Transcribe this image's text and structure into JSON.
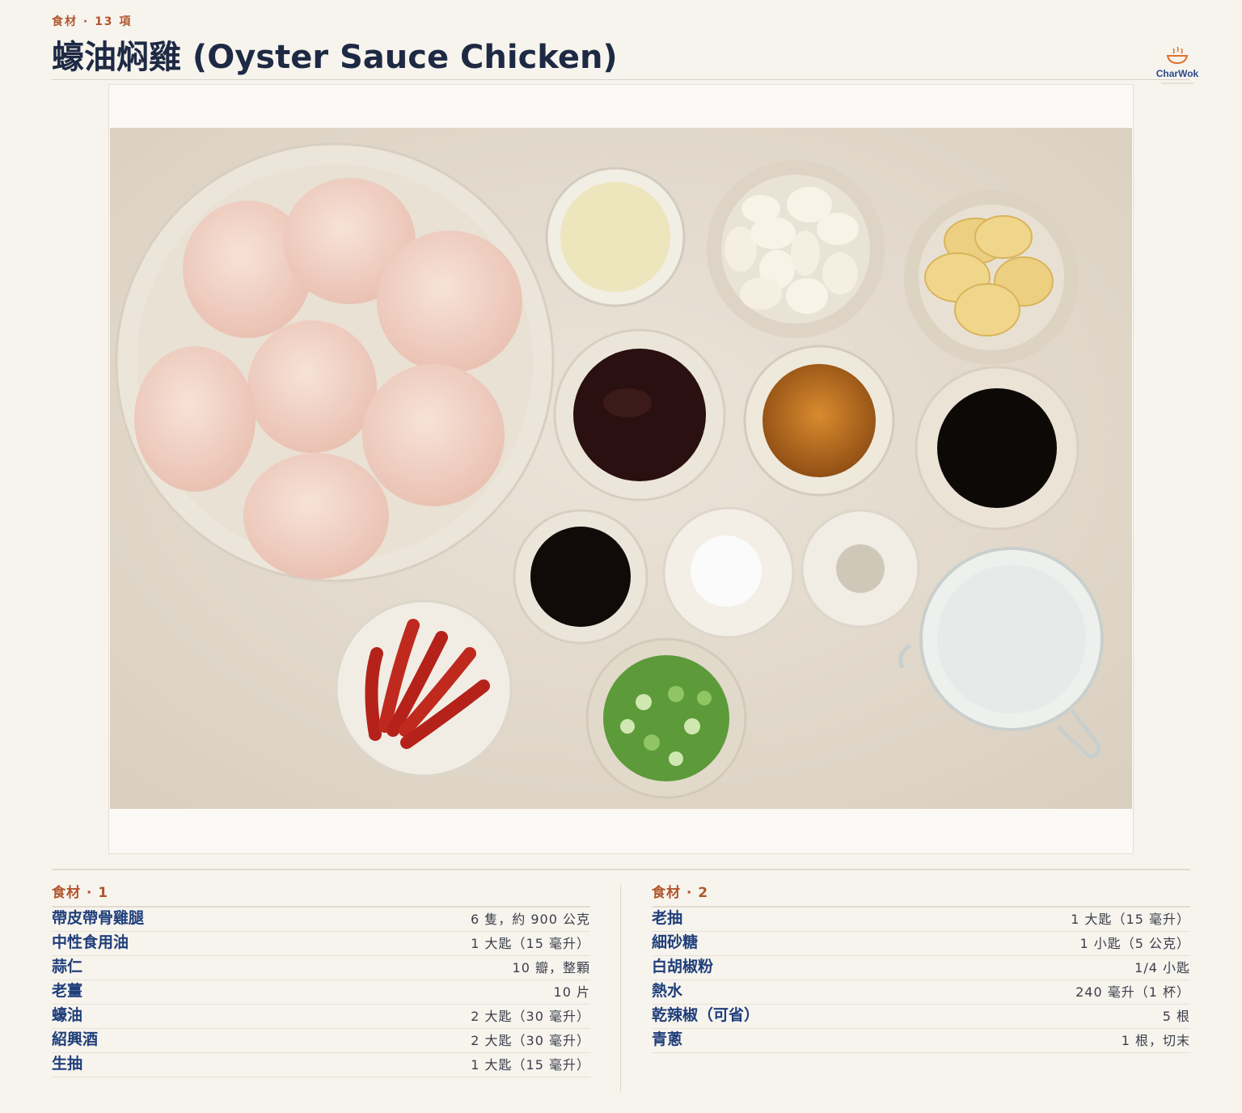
{
  "header": {
    "eyebrow": "食材 · 13 項",
    "title": "蠔油焖雞 (Oyster Sauce Chicken)"
  },
  "brand": {
    "name": "CharWok"
  },
  "photo": {
    "alt": "Top-down photo of oyster sauce chicken ingredients arranged in bowls"
  },
  "ingredients": [
    {
      "heading": "食材 · 1",
      "items": [
        {
          "name": "帶皮帶骨雞腿",
          "qty": "6 隻，約 900 公克"
        },
        {
          "name": "中性食用油",
          "qty": "1 大匙（15 毫升）"
        },
        {
          "name": "蒜仁",
          "qty": "10 瓣，整顆"
        },
        {
          "name": "老薑",
          "qty": "10 片"
        },
        {
          "name": "蠔油",
          "qty": "2 大匙（30 毫升）"
        },
        {
          "name": "紹興酒",
          "qty": "2 大匙（30 毫升）"
        },
        {
          "name": "生抽",
          "qty": "1 大匙（15 毫升）"
        }
      ]
    },
    {
      "heading": "食材 · 2",
      "items": [
        {
          "name": "老抽",
          "qty": "1 大匙（15 毫升）"
        },
        {
          "name": "細砂糖",
          "qty": "1 小匙（5 公克）"
        },
        {
          "name": "白胡椒粉",
          "qty": "1/4 小匙"
        },
        {
          "name": "熱水",
          "qty": "240 毫升（1 杯）"
        },
        {
          "name": "乾辣椒（可省）",
          "qty": "5 根"
        },
        {
          "name": "青蔥",
          "qty": "1 根，切末"
        }
      ]
    }
  ],
  "colors": {
    "accent": "#b2552e",
    "ink": "#1f3e7a",
    "background": "#f7f4ee"
  }
}
